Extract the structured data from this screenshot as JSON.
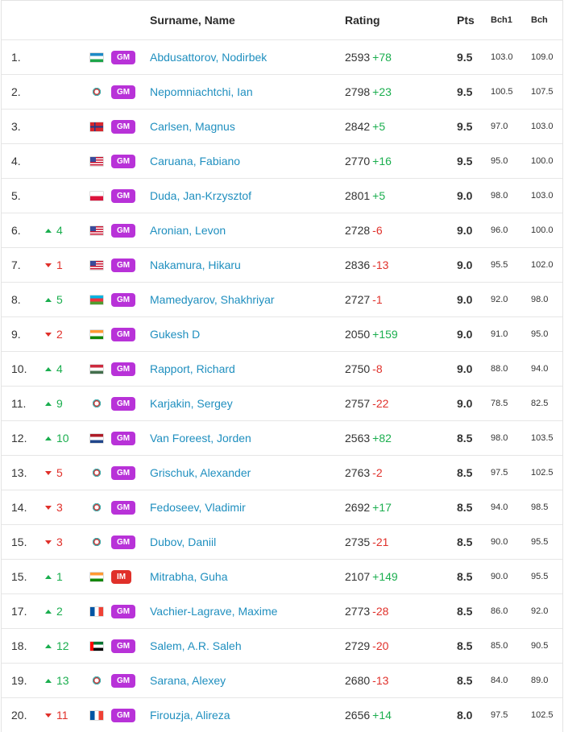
{
  "header": {
    "name": "Surname, Name",
    "rating": "Rating",
    "pts": "Pts",
    "bch1": "Bch1",
    "bch": "Bch"
  },
  "colors": {
    "name_link": "#1f8fbf",
    "positive": "#1aae4e",
    "negative": "#e0302a",
    "gm_badge": "#b832d8",
    "im_badge": "#e0302a"
  },
  "rows": [
    {
      "rank": "1.",
      "move": "",
      "dir": "",
      "flag": "uz",
      "title": "GM",
      "name": "Abdusattorov, Nodirbek",
      "rating": "2593",
      "delta": "+78",
      "pts": "9.5",
      "bch1": "103.0",
      "bch": "109.0"
    },
    {
      "rank": "2.",
      "move": "",
      "dir": "",
      "flag": "fide",
      "title": "GM",
      "name": "Nepomniachtchi, Ian",
      "rating": "2798",
      "delta": "+23",
      "pts": "9.5",
      "bch1": "100.5",
      "bch": "107.5"
    },
    {
      "rank": "3.",
      "move": "",
      "dir": "",
      "flag": "no",
      "title": "GM",
      "name": "Carlsen, Magnus",
      "rating": "2842",
      "delta": "+5",
      "pts": "9.5",
      "bch1": "97.0",
      "bch": "103.0"
    },
    {
      "rank": "4.",
      "move": "",
      "dir": "",
      "flag": "us",
      "title": "GM",
      "name": "Caruana, Fabiano",
      "rating": "2770",
      "delta": "+16",
      "pts": "9.5",
      "bch1": "95.0",
      "bch": "100.0"
    },
    {
      "rank": "5.",
      "move": "",
      "dir": "",
      "flag": "pl",
      "title": "GM",
      "name": "Duda, Jan-Krzysztof",
      "rating": "2801",
      "delta": "+5",
      "pts": "9.0",
      "bch1": "98.0",
      "bch": "103.0"
    },
    {
      "rank": "6.",
      "move": "4",
      "dir": "up",
      "flag": "us",
      "title": "GM",
      "name": "Aronian, Levon",
      "rating": "2728",
      "delta": "-6",
      "pts": "9.0",
      "bch1": "96.0",
      "bch": "100.0"
    },
    {
      "rank": "7.",
      "move": "1",
      "dir": "down",
      "flag": "us",
      "title": "GM",
      "name": "Nakamura, Hikaru",
      "rating": "2836",
      "delta": "-13",
      "pts": "9.0",
      "bch1": "95.5",
      "bch": "102.0"
    },
    {
      "rank": "8.",
      "move": "5",
      "dir": "up",
      "flag": "az",
      "title": "GM",
      "name": "Mamedyarov, Shakhriyar",
      "rating": "2727",
      "delta": "-1",
      "pts": "9.0",
      "bch1": "92.0",
      "bch": "98.0"
    },
    {
      "rank": "9.",
      "move": "2",
      "dir": "down",
      "flag": "in",
      "title": "GM",
      "name": "Gukesh D",
      "rating": "2050",
      "delta": "+159",
      "pts": "9.0",
      "bch1": "91.0",
      "bch": "95.0"
    },
    {
      "rank": "10.",
      "move": "4",
      "dir": "up",
      "flag": "hu",
      "title": "GM",
      "name": "Rapport, Richard",
      "rating": "2750",
      "delta": "-8",
      "pts": "9.0",
      "bch1": "88.0",
      "bch": "94.0"
    },
    {
      "rank": "11.",
      "move": "9",
      "dir": "up",
      "flag": "fide",
      "title": "GM",
      "name": "Karjakin, Sergey",
      "rating": "2757",
      "delta": "-22",
      "pts": "9.0",
      "bch1": "78.5",
      "bch": "82.5"
    },
    {
      "rank": "12.",
      "move": "10",
      "dir": "up",
      "flag": "nl",
      "title": "GM",
      "name": "Van Foreest, Jorden",
      "rating": "2563",
      "delta": "+82",
      "pts": "8.5",
      "bch1": "98.0",
      "bch": "103.5"
    },
    {
      "rank": "13.",
      "move": "5",
      "dir": "down",
      "flag": "fide",
      "title": "GM",
      "name": "Grischuk, Alexander",
      "rating": "2763",
      "delta": "-2",
      "pts": "8.5",
      "bch1": "97.5",
      "bch": "102.5"
    },
    {
      "rank": "14.",
      "move": "3",
      "dir": "down",
      "flag": "fide",
      "title": "GM",
      "name": "Fedoseev, Vladimir",
      "rating": "2692",
      "delta": "+17",
      "pts": "8.5",
      "bch1": "94.0",
      "bch": "98.5"
    },
    {
      "rank": "15.",
      "move": "3",
      "dir": "down",
      "flag": "fide",
      "title": "GM",
      "name": "Dubov, Daniil",
      "rating": "2735",
      "delta": "-21",
      "pts": "8.5",
      "bch1": "90.0",
      "bch": "95.5"
    },
    {
      "rank": "15.",
      "move": "1",
      "dir": "up",
      "flag": "in",
      "title": "IM",
      "name": "Mitrabha, Guha",
      "rating": "2107",
      "delta": "+149",
      "pts": "8.5",
      "bch1": "90.0",
      "bch": "95.5"
    },
    {
      "rank": "17.",
      "move": "2",
      "dir": "up",
      "flag": "fr",
      "title": "GM",
      "name": "Vachier-Lagrave, Maxime",
      "rating": "2773",
      "delta": "-28",
      "pts": "8.5",
      "bch1": "86.0",
      "bch": "92.0"
    },
    {
      "rank": "18.",
      "move": "12",
      "dir": "up",
      "flag": "ae",
      "title": "GM",
      "name": "Salem, A.R. Saleh",
      "rating": "2729",
      "delta": "-20",
      "pts": "8.5",
      "bch1": "85.0",
      "bch": "90.5"
    },
    {
      "rank": "19.",
      "move": "13",
      "dir": "up",
      "flag": "fide",
      "title": "GM",
      "name": "Sarana, Alexey",
      "rating": "2680",
      "delta": "-13",
      "pts": "8.5",
      "bch1": "84.0",
      "bch": "89.0"
    },
    {
      "rank": "20.",
      "move": "11",
      "dir": "down",
      "flag": "fr",
      "title": "GM",
      "name": "Firouzja, Alireza",
      "rating": "2656",
      "delta": "+14",
      "pts": "8.0",
      "bch1": "97.5",
      "bch": "102.5"
    }
  ]
}
